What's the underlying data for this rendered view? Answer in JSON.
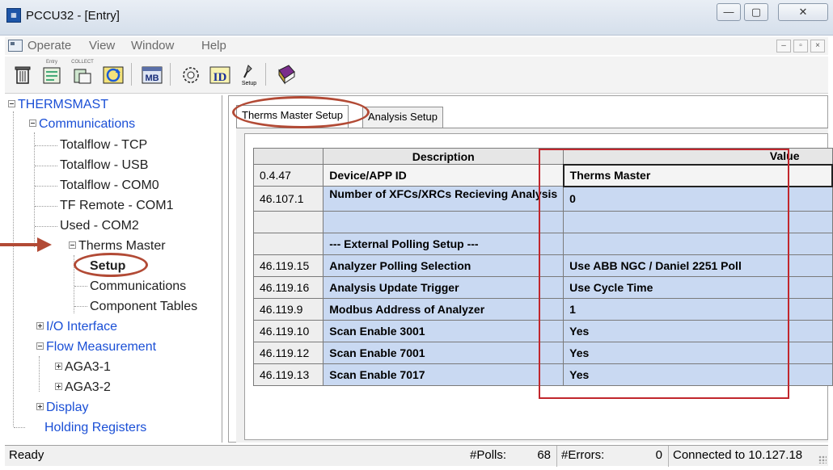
{
  "window": {
    "title": "PCCU32 - [Entry]",
    "app_icon": "pccu-app-icon",
    "controls": {
      "minimize": "—",
      "maximize": "▢",
      "close": "✕"
    }
  },
  "menu": {
    "items": [
      "Operate",
      "View",
      "Window",
      "Help"
    ],
    "mdi_controls": [
      "–",
      "▫",
      "×"
    ]
  },
  "toolbar": {
    "buttons": [
      {
        "name": "trash-icon",
        "caption": ""
      },
      {
        "name": "entry-icon",
        "caption": "Entry"
      },
      {
        "name": "collect-icon",
        "caption": "COLLECT"
      },
      {
        "name": "refresh-icon",
        "caption": ""
      },
      {
        "name": "modbus-icon",
        "caption": "MB"
      },
      {
        "name": "gear-settings-icon",
        "caption": ""
      },
      {
        "name": "id-icon",
        "caption": "ID"
      },
      {
        "name": "setup-icon",
        "caption": "Setup"
      },
      {
        "name": "help-book-icon",
        "caption": ""
      }
    ]
  },
  "tree": {
    "root": "THERMSMAST",
    "nodes": {
      "communications": "Communications",
      "tcp": "Totalflow - TCP",
      "usb": "Totalflow - USB",
      "com0": "Totalflow - COM0",
      "com1": "TF Remote - COM1",
      "com2": "Used - COM2",
      "therms_master": "Therms Master",
      "setup": "Setup",
      "tm_communications": "Communications",
      "component_tables": "Component Tables",
      "io_interface": "I/O Interface",
      "flow_measurement": "Flow Measurement",
      "aga3_1": "AGA3-1",
      "aga3_2": "AGA3-2",
      "display": "Display",
      "holding_registers": "Holding Registers"
    }
  },
  "tabs": [
    "Therms Master Setup",
    "Analysis Setup"
  ],
  "grid": {
    "headers": [
      "",
      "Description",
      "Value"
    ],
    "rows": [
      {
        "register": "0.4.47",
        "description": "Device/APP ID",
        "value": "Therms Master"
      },
      {
        "register": "46.107.1",
        "description": "Number of XFCs/XRCs Recieving Analysis",
        "value": "0"
      },
      {
        "register": "",
        "description": "",
        "value": ""
      },
      {
        "register": "",
        "description": "--- External Polling Setup ---",
        "value": ""
      },
      {
        "register": "46.119.15",
        "description": "Analyzer Polling Selection",
        "value": "Use ABB NGC / Daniel 2251 Poll"
      },
      {
        "register": "46.119.16",
        "description": "Analysis Update Trigger",
        "value": "Use Cycle Time"
      },
      {
        "register": "46.119.9",
        "description": "Modbus Address of Analyzer",
        "value": "1"
      },
      {
        "register": "46.119.10",
        "description": "Scan Enable 3001",
        "value": "Yes"
      },
      {
        "register": "46.119.12",
        "description": "Scan Enable 7001",
        "value": "Yes"
      },
      {
        "register": "46.119.13",
        "description": "Scan Enable 7017",
        "value": "Yes"
      }
    ]
  },
  "status": {
    "ready": "Ready",
    "polls_label": "#Polls:",
    "polls_value": "68",
    "errors_label": "#Errors:",
    "errors_value": "0",
    "connection": "Connected to 10.127.18"
  },
  "colors": {
    "annotation_red": "#c1272d",
    "annotation_brown": "#b24a35",
    "row_blue": "#c9d9f2",
    "tree_link": "#1a4fd6"
  }
}
